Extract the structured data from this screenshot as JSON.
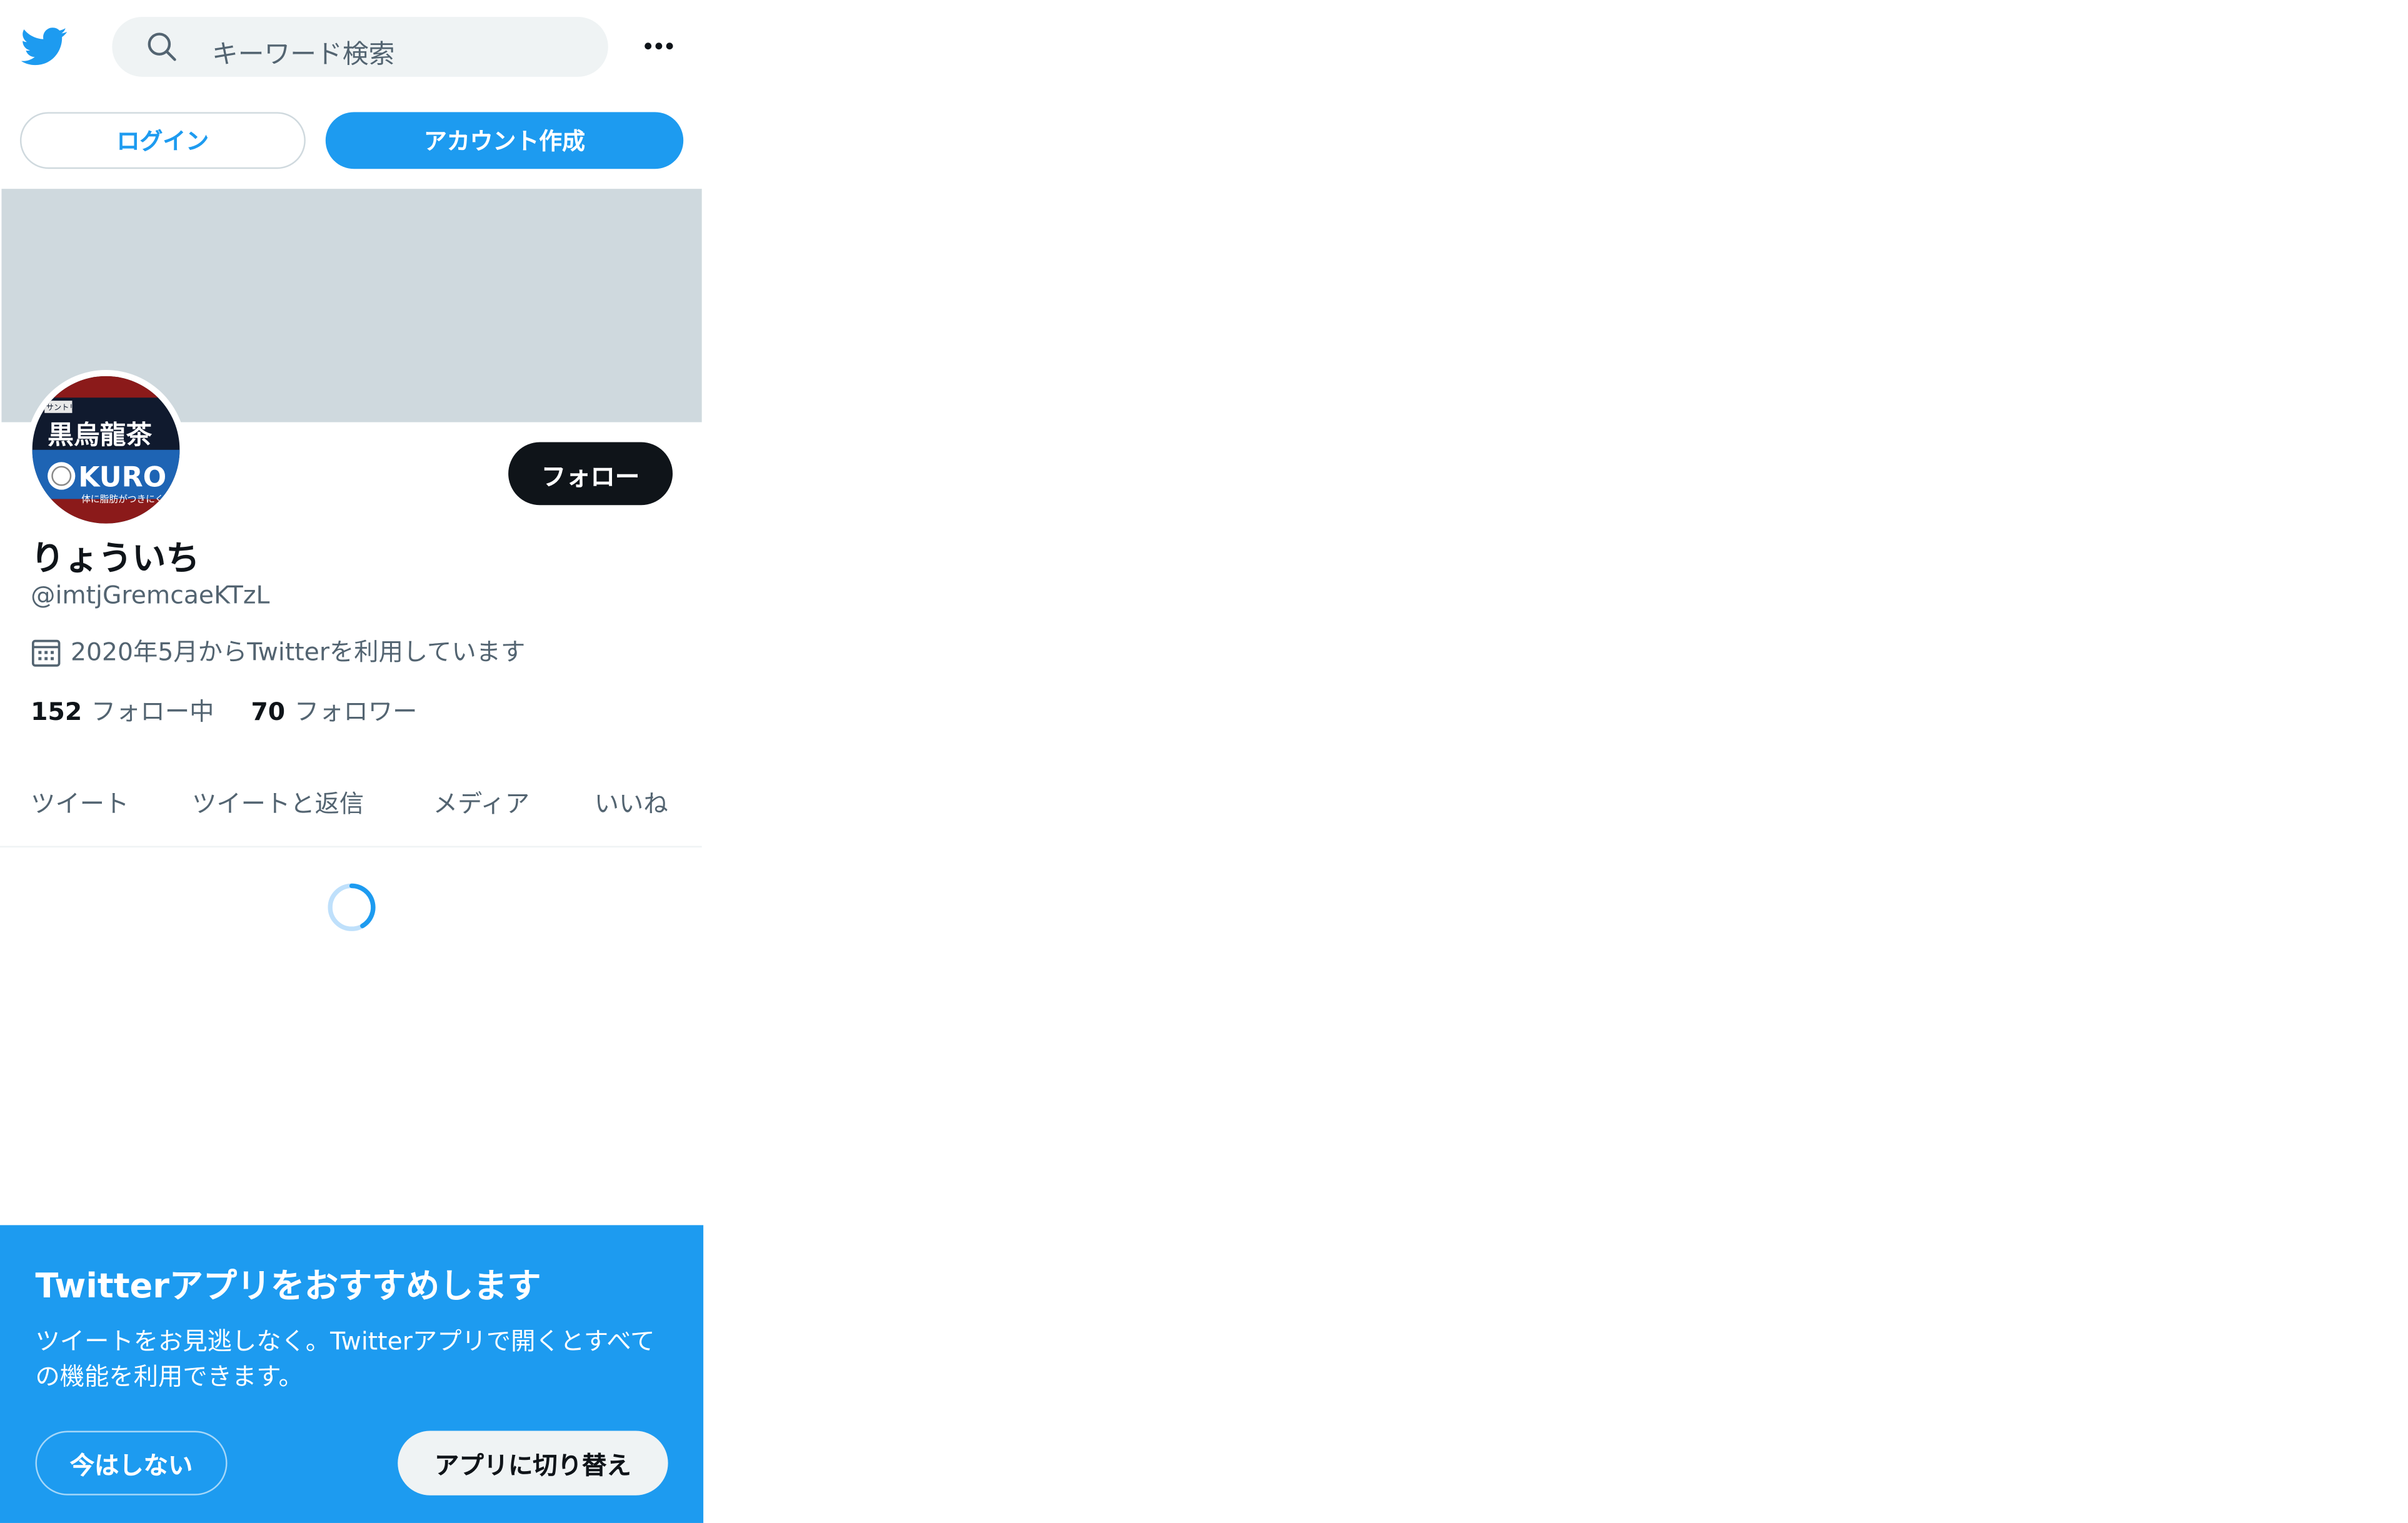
{
  "colors": {
    "brand": "#1d9bf0",
    "text_primary": "#0f1419",
    "text_secondary": "#536471",
    "banner": "#cfd9de"
  },
  "header": {
    "logo_icon": "twitter-bird-icon",
    "search_placeholder": "キーワード検索",
    "search_icon": "search-icon",
    "more_icon": "more-horizontal-icon"
  },
  "auth": {
    "login_label": "ログイン",
    "signup_label": "アカウント作成"
  },
  "profile": {
    "avatar_text": {
      "brand_small": "サントリー",
      "brand_main": "黒烏龍茶",
      "brand_latin": "KURO",
      "tagline": "体に脂肪がつきにくい"
    },
    "follow_label": "フォロー",
    "display_name": "りょういち",
    "handle": "@imtjGremcaeKTzL",
    "joined_icon": "calendar-icon",
    "joined_text": "2020年5月からTwitterを利用しています",
    "following_count": "152",
    "following_label": "フォロー中",
    "followers_count": "70",
    "followers_label": "フォロワー"
  },
  "tabs": [
    {
      "label": "ツイート"
    },
    {
      "label": "ツイートと返信"
    },
    {
      "label": "メディア"
    },
    {
      "label": "いいね"
    }
  ],
  "promo": {
    "title": "Twitterアプリをおすすめします",
    "description": "ツイートをお見逃しなく。Twitterアプリで開くとすべての機能を利用できます。",
    "dismiss_label": "今はしない",
    "switch_label": "アプリに切り替え"
  }
}
